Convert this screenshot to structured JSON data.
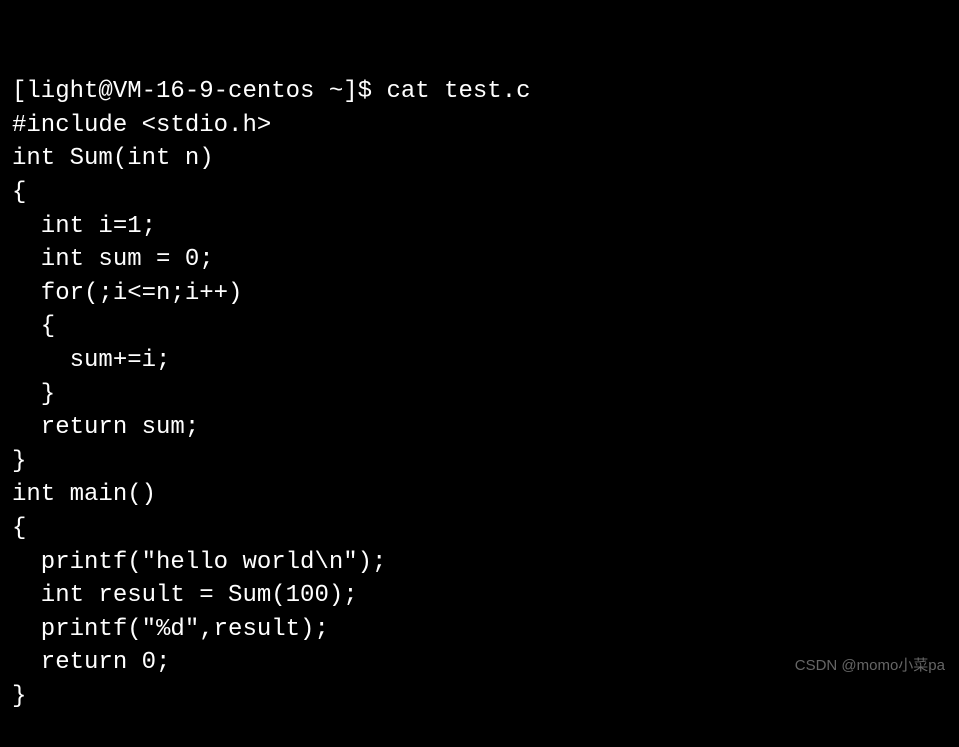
{
  "terminal": {
    "prompt": "[light@VM-16-9-centos ~]$ ",
    "command": "cat test.c",
    "lines": [
      "#include <stdio.h>",
      "",
      "int Sum(int n)",
      "{",
      "  int i=1;",
      "  int sum = 0;",
      "  for(;i<=n;i++)",
      "  {",
      "    sum+=i;",
      "  }",
      "  return sum;",
      "}",
      "int main()",
      "{",
      "  printf(\"hello world\\n\");",
      "  int result = Sum(100);",
      "  printf(\"%d\",result);",
      "  return 0;",
      "}"
    ]
  },
  "watermark": "CSDN @momo小菜pa"
}
